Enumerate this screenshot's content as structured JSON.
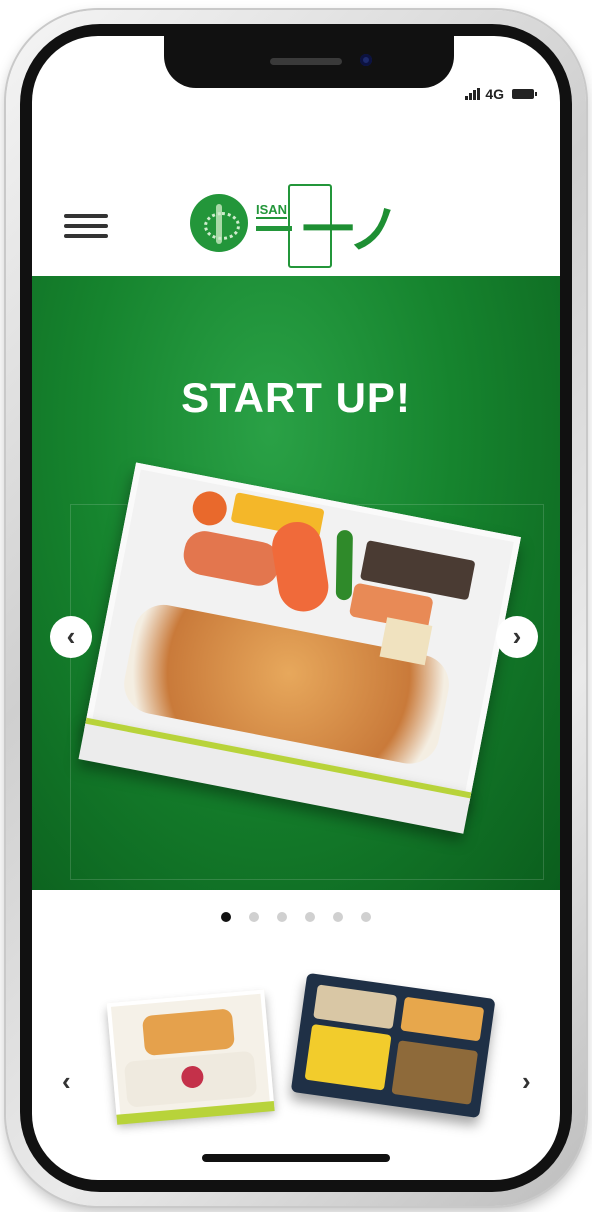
{
  "status_bar": {
    "network": "4G"
  },
  "header": {
    "menu_icon": "hamburger-menu-icon",
    "logo": {
      "brand_small": "ISAN",
      "brand_kanji": "一ノ膳"
    }
  },
  "hero": {
    "title": "START UP!",
    "prev_glyph": "‹",
    "next_glyph": "›",
    "slide_count": 6,
    "active_slide": 1
  },
  "carousel_strip": {
    "prev_glyph": "‹",
    "next_glyph": "›",
    "items": [
      "bento-thumbnail-1",
      "bento-thumbnail-2"
    ]
  },
  "colors": {
    "brand_green": "#1e8f33",
    "hero_green": "#16842e",
    "accent_lime": "#b8d33a"
  }
}
